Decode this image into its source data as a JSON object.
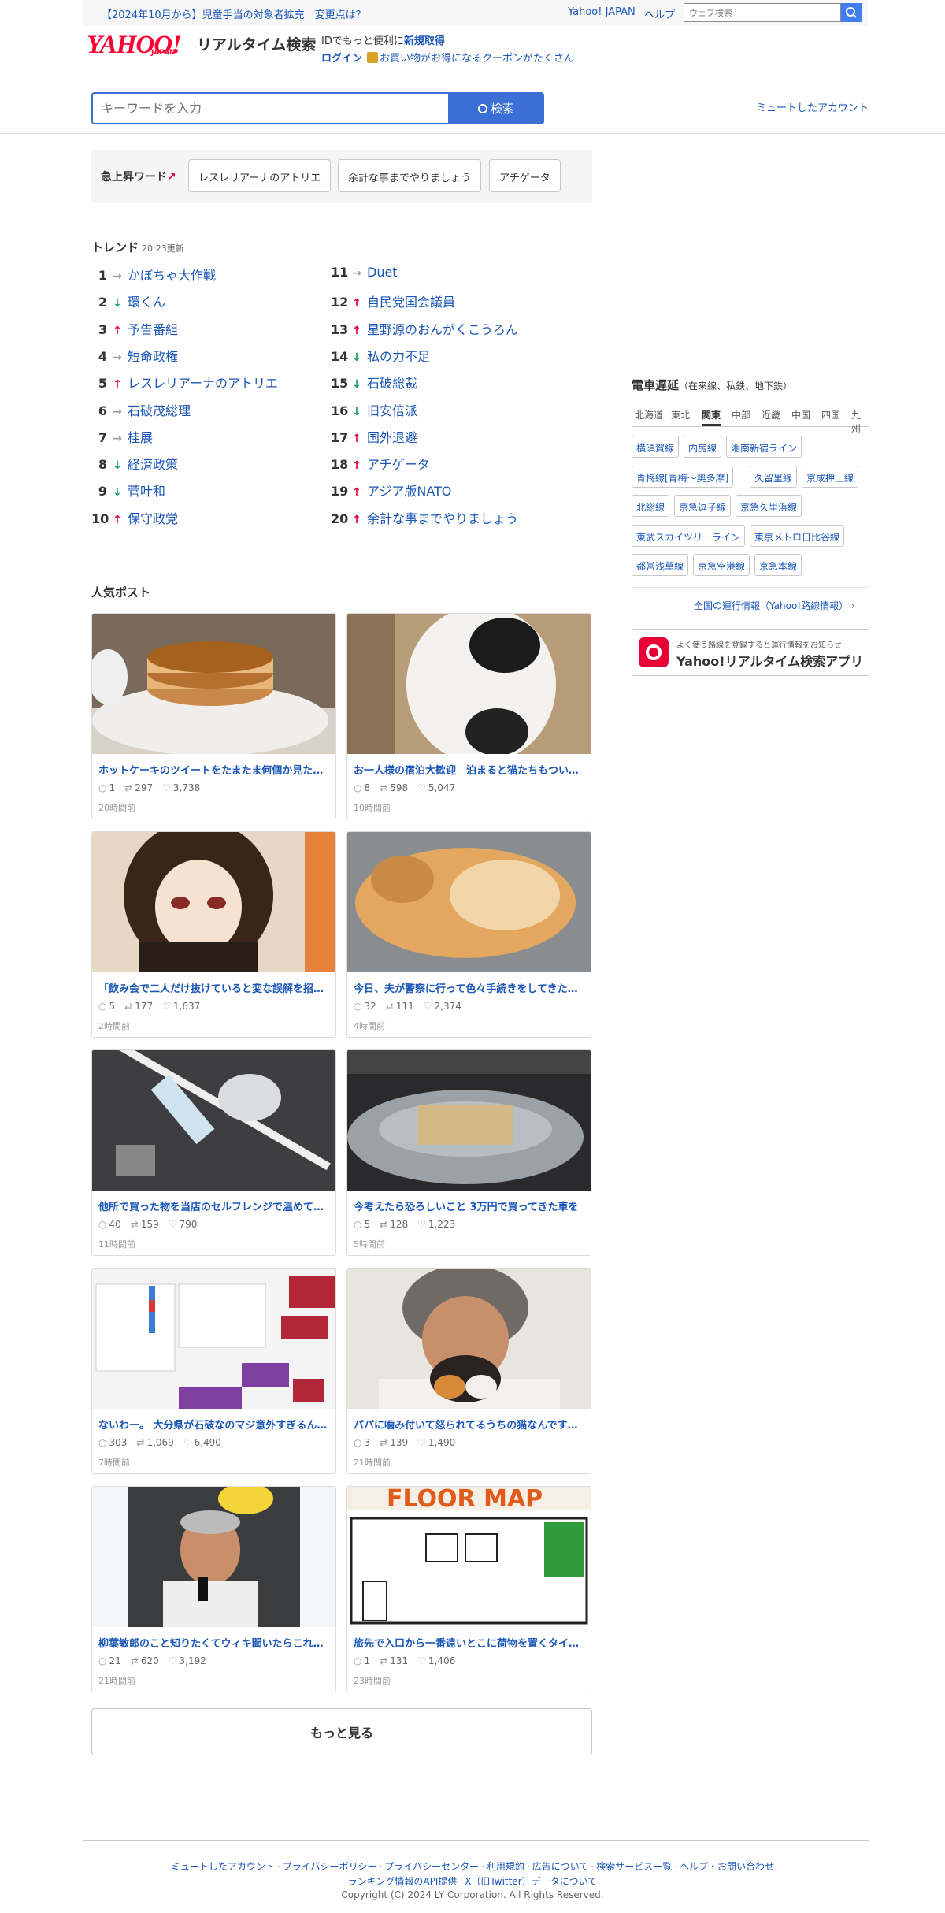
{
  "topbar": {
    "announcement": "【2024年10月から】児童手当の対象者拡充　変更点は？",
    "yahoo_japan": "Yahoo! JAPAN",
    "help": "ヘルプ",
    "web_search_placeholder": "ウェブ検索"
  },
  "header": {
    "logo_text": "YAHOO!",
    "logo_sub": "JAPAN",
    "service_name": "リアルタイム検索",
    "id_promo_text": "IDでもっと便利に",
    "id_promo_link": "新規取得",
    "login": "ログイン",
    "coupon_text": "お買い物がお得になるクーポンがたくさん"
  },
  "search": {
    "placeholder": "キーワードを入力",
    "button_label": "検索",
    "muted_accounts": "ミュートしたアカウント"
  },
  "rising": {
    "label": "急上昇ワード",
    "words": [
      "レスレリアーナのアトリエ",
      "余計な事までやりましょう",
      "アチゲータ"
    ]
  },
  "trends": {
    "title": "トレンド",
    "updated": "20:23更新",
    "items": [
      {
        "rank": "1",
        "dir": "flat",
        "arrow": "→",
        "word": "かぼちゃ大作戦"
      },
      {
        "rank": "2",
        "dir": "down",
        "arrow": "↓",
        "word": "環くん"
      },
      {
        "rank": "3",
        "dir": "up",
        "arrow": "↑",
        "word": "予告番組"
      },
      {
        "rank": "4",
        "dir": "flat",
        "arrow": "→",
        "word": "短命政権"
      },
      {
        "rank": "5",
        "dir": "up",
        "arrow": "↑",
        "word": "レスレリアーナのアトリエ"
      },
      {
        "rank": "6",
        "dir": "flat",
        "arrow": "→",
        "word": "石破茂総理"
      },
      {
        "rank": "7",
        "dir": "flat",
        "arrow": "→",
        "word": "桂展"
      },
      {
        "rank": "8",
        "dir": "down",
        "arrow": "↓",
        "word": "経済政策"
      },
      {
        "rank": "9",
        "dir": "down",
        "arrow": "↓",
        "word": "菅叶和"
      },
      {
        "rank": "10",
        "dir": "up",
        "arrow": "↑",
        "word": "保守政党"
      },
      {
        "rank": "11",
        "dir": "flat",
        "arrow": "→",
        "word": "Duet"
      },
      {
        "rank": "12",
        "dir": "up",
        "arrow": "↑",
        "word": "自民党国会議員"
      },
      {
        "rank": "13",
        "dir": "up",
        "arrow": "↑",
        "word": "星野源のおんがくこうろん"
      },
      {
        "rank": "14",
        "dir": "down",
        "arrow": "↓",
        "word": "私の力不足"
      },
      {
        "rank": "15",
        "dir": "down",
        "arrow": "↓",
        "word": "石破総裁"
      },
      {
        "rank": "16",
        "dir": "down",
        "arrow": "↓",
        "word": "旧安倍派"
      },
      {
        "rank": "17",
        "dir": "up",
        "arrow": "↑",
        "word": "国外退避"
      },
      {
        "rank": "18",
        "dir": "up",
        "arrow": "↑",
        "word": "アチゲータ"
      },
      {
        "rank": "19",
        "dir": "up",
        "arrow": "↑",
        "word": "アジア版NATO"
      },
      {
        "rank": "20",
        "dir": "up",
        "arrow": "↑",
        "word": "余計な事までやりましょう"
      }
    ]
  },
  "posts": {
    "title": "人気ポスト",
    "items": [
      {
        "title": "ホットケーキのツイートをたまたま何個か見たんだけど",
        "replies": "1",
        "reposts": "297",
        "likes": "3,738",
        "ago": "20時間前",
        "image": "pancake"
      },
      {
        "title": "お一人様の宿泊大歓迎　泊まると猫たちもついてくる",
        "replies": "8",
        "reposts": "598",
        "likes": "5,047",
        "ago": "10時間前",
        "image": "cat-bw"
      },
      {
        "title": "「飲み会で二人だけ抜けていると変な誤解を招くので",
        "replies": "5",
        "reposts": "177",
        "likes": "1,637",
        "ago": "2時間前",
        "image": "anime-girl"
      },
      {
        "title": "今日、夫が警察に行って色々手続きをしてきたのですが",
        "replies": "32",
        "reposts": "111",
        "likes": "2,374",
        "ago": "4時間前",
        "image": "cat-orange"
      },
      {
        "title": "他所で買った物を当店のセルフレンジで温めていく人へ",
        "replies": "40",
        "reposts": "159",
        "likes": "790",
        "ago": "11時間前",
        "image": "trash"
      },
      {
        "title": "今考えたら恐ろしいこと 3万円で買ってきた車を",
        "replies": "5",
        "reposts": "128",
        "likes": "1,223",
        "ago": "5時間前",
        "image": "car"
      },
      {
        "title": "ないわー。 大分県が石破なのマジ意外すぎるんだけど",
        "replies": "303",
        "reposts": "1,069",
        "likes": "6,490",
        "ago": "7時間前",
        "image": "map"
      },
      {
        "title": "パパに噛み付いて怒られてるうちの猫なんですけど",
        "replies": "3",
        "reposts": "139",
        "likes": "1,490",
        "ago": "21時間前",
        "image": "man-cat"
      },
      {
        "title": "柳葉敏郎のこと知りたくてウィキ聞いたらこれが出てきた",
        "replies": "21",
        "reposts": "620",
        "likes": "3,192",
        "ago": "21時間前",
        "image": "baseball"
      },
      {
        "title": "旅先で入口から一番遠いとこに荷物を置くタイプの人",
        "replies": "1",
        "reposts": "131",
        "likes": "1,406",
        "ago": "23時間前",
        "image": "floormap"
      }
    ],
    "more_button": "もっと見る"
  },
  "trains": {
    "title": "電車遅延",
    "subtitle": "（在来線、私鉄、地下鉄）",
    "regions": [
      "北海道",
      "東北",
      "関東",
      "中部",
      "近畿",
      "中国",
      "四国",
      "九州"
    ],
    "active_region": "関東",
    "lines": [
      "横須賀線",
      "内房線",
      "湘南新宿ライン",
      "青梅線[青梅〜奥多摩]",
      "久留里線",
      "京成押上線",
      "北総線",
      "京急逗子線",
      "京急久里浜線",
      "東武スカイツリーライン",
      "東京メトロ日比谷線",
      "都営浅草線",
      "京急空港線",
      "京急本線"
    ],
    "all_info_link": "全国の運行情報（Yahoo!路線情報）",
    "app_small": "よく使う路線を登録すると運行情報をお知らせ",
    "app_large": "Yahoo!リアルタイム検索アプリ"
  },
  "footer": {
    "links_row1": [
      "ミュートしたアカウント",
      "プライバシーポリシー",
      "プライバシーセンター",
      "利用規約",
      "広告について",
      "検索サービス一覧",
      "ヘルプ・お問い合わせ"
    ],
    "links_row2": [
      "ランキング情報のAPI提供",
      "X（旧Twitter）データについて"
    ],
    "copyright": "Copyright (C) 2024 LY Corporation. All Rights Reserved."
  },
  "colors": {
    "link": "#1a56b8",
    "accent": "#3c6fd6",
    "up": "#e60033",
    "down": "#13a159",
    "brand": "#ff0033"
  }
}
